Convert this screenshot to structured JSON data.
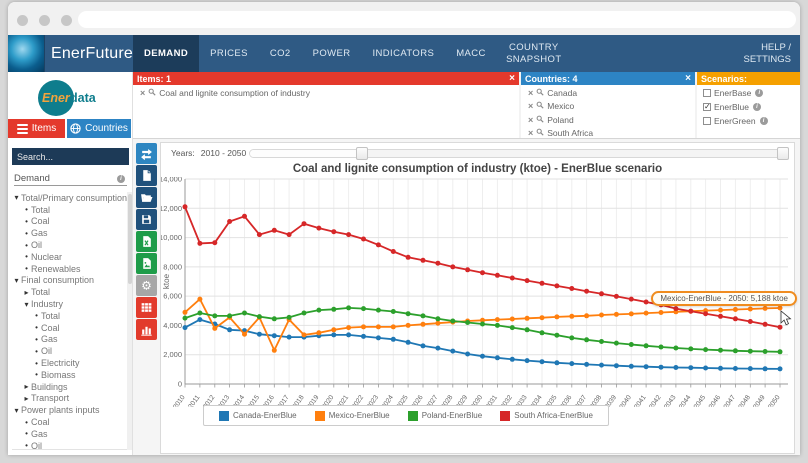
{
  "header": {
    "brand": "EnerFuture",
    "nav": [
      {
        "label": "DEMAND",
        "active": true
      },
      {
        "label": "PRICES",
        "active": false
      },
      {
        "label": "CO2",
        "active": false
      },
      {
        "label": "POWER",
        "active": false
      },
      {
        "label": "INDICATORS",
        "active": false
      },
      {
        "label": "MACC",
        "active": false
      },
      {
        "label": "COUNTRY SNAPSHOT",
        "active": false
      }
    ],
    "help": "HELP / SETTINGS"
  },
  "filters": {
    "items": {
      "title": "Items: 1",
      "rows": [
        "Coal and lignite consumption of industry"
      ]
    },
    "countries": {
      "title": "Countries: 4",
      "rows": [
        "Canada",
        "Mexico",
        "Poland",
        "South Africa"
      ]
    },
    "scenarios": {
      "title": "Scenarios:",
      "options": [
        {
          "label": "EnerBase",
          "checked": false
        },
        {
          "label": "EnerBlue",
          "checked": true
        },
        {
          "label": "EnerGreen",
          "checked": false
        }
      ]
    }
  },
  "sidebar": {
    "logo_primary": "Ener",
    "logo_secondary": "data",
    "tabs": [
      {
        "label": "Items",
        "icon": "menu-icon",
        "active": true
      },
      {
        "label": "Countries",
        "icon": "globe-icon",
        "active": false
      }
    ],
    "search_placeholder": "Search...",
    "category": "Demand",
    "tree": [
      {
        "label": "Total/Primary consumption",
        "level": 0,
        "state": "expanded"
      },
      {
        "label": "Total",
        "level": 1,
        "state": "leaf"
      },
      {
        "label": "Coal",
        "level": 1,
        "state": "leaf"
      },
      {
        "label": "Gas",
        "level": 1,
        "state": "leaf"
      },
      {
        "label": "Oil",
        "level": 1,
        "state": "leaf"
      },
      {
        "label": "Nuclear",
        "level": 1,
        "state": "leaf"
      },
      {
        "label": "Renewables",
        "level": 1,
        "state": "leaf"
      },
      {
        "label": "Final consumption",
        "level": 0,
        "state": "expanded"
      },
      {
        "label": "Total",
        "level": 1,
        "state": "collapsed"
      },
      {
        "label": "Industry",
        "level": 1,
        "state": "expanded"
      },
      {
        "label": "Total",
        "level": 2,
        "state": "leaf"
      },
      {
        "label": "Coal",
        "level": 2,
        "state": "leaf"
      },
      {
        "label": "Gas",
        "level": 2,
        "state": "leaf"
      },
      {
        "label": "Oil",
        "level": 2,
        "state": "leaf"
      },
      {
        "label": "Electricity",
        "level": 2,
        "state": "leaf"
      },
      {
        "label": "Biomass",
        "level": 2,
        "state": "leaf"
      },
      {
        "label": "Buildings",
        "level": 1,
        "state": "collapsed"
      },
      {
        "label": "Transport",
        "level": 1,
        "state": "collapsed"
      },
      {
        "label": "Power plants inputs",
        "level": 0,
        "state": "expanded"
      },
      {
        "label": "Coal",
        "level": 1,
        "state": "leaf"
      },
      {
        "label": "Gas",
        "level": 1,
        "state": "leaf"
      },
      {
        "label": "Oil",
        "level": 1,
        "state": "leaf"
      }
    ]
  },
  "toolbar": {
    "buttons": [
      {
        "name": "swap-arrows",
        "color": "#2e86c1"
      },
      {
        "name": "new-document",
        "color": "#20517c"
      },
      {
        "name": "open-folder",
        "color": "#20517c"
      },
      {
        "name": "save",
        "color": "#20517c"
      },
      {
        "name": "export-excel",
        "color": "#1e9c49"
      },
      {
        "name": "export-image",
        "color": "#1e9c49"
      },
      {
        "name": "settings-gear",
        "color": "#a6a6a6"
      },
      {
        "name": "data-table",
        "color": "#e23b2c"
      },
      {
        "name": "bar-chart",
        "color": "#e23b2c"
      }
    ]
  },
  "slider": {
    "label": "Years:",
    "value": "2010 - 2050"
  },
  "tooltip": {
    "text": "Mexico-EnerBlue - 2050: 5,188 ktoe"
  },
  "chart_data": {
    "type": "line",
    "title": "Coal and lignite consumption of industry (ktoe) - EnerBlue scenario",
    "ylabel": "ktoe",
    "ylim": [
      0,
      14000
    ],
    "ytick_step": 2000,
    "grid": true,
    "legend_position": "bottom",
    "x": [
      2010,
      2011,
      2012,
      2013,
      2014,
      2015,
      2016,
      2017,
      2018,
      2019,
      2020,
      2021,
      2022,
      2023,
      2024,
      2025,
      2026,
      2027,
      2028,
      2029,
      2030,
      2031,
      2032,
      2033,
      2034,
      2035,
      2036,
      2037,
      2038,
      2039,
      2040,
      2041,
      2042,
      2043,
      2044,
      2045,
      2046,
      2047,
      2048,
      2049,
      2050
    ],
    "series": [
      {
        "name": "Canada-EnerBlue",
        "color": "#1f77b4",
        "values": [
          3850,
          4400,
          4100,
          3700,
          3650,
          3400,
          3300,
          3200,
          3200,
          3300,
          3350,
          3350,
          3250,
          3150,
          3050,
          2850,
          2600,
          2450,
          2250,
          2050,
          1900,
          1790,
          1690,
          1600,
          1520,
          1450,
          1390,
          1340,
          1290,
          1250,
          1210,
          1180,
          1150,
          1130,
          1110,
          1090,
          1070,
          1060,
          1050,
          1040,
          1030
        ]
      },
      {
        "name": "Mexico-EnerBlue",
        "color": "#ff7f0e",
        "values": [
          4900,
          5800,
          3800,
          4550,
          3400,
          4550,
          2300,
          4400,
          3350,
          3500,
          3700,
          3850,
          3900,
          3900,
          3900,
          4000,
          4080,
          4150,
          4230,
          4300,
          4350,
          4400,
          4440,
          4490,
          4530,
          4580,
          4620,
          4660,
          4710,
          4750,
          4790,
          4840,
          4880,
          4930,
          4970,
          5010,
          5050,
          5090,
          5120,
          5160,
          5188
        ]
      },
      {
        "name": "Poland-EnerBlue",
        "color": "#2ca02c",
        "values": [
          4500,
          4850,
          4650,
          4650,
          4850,
          4600,
          4450,
          4550,
          4850,
          5050,
          5100,
          5200,
          5150,
          5050,
          4950,
          4800,
          4650,
          4450,
          4300,
          4200,
          4100,
          4000,
          3850,
          3700,
          3500,
          3330,
          3150,
          3020,
          2900,
          2790,
          2700,
          2610,
          2530,
          2460,
          2400,
          2350,
          2310,
          2270,
          2240,
          2220,
          2200
        ]
      },
      {
        "name": "South Africa-EnerBlue",
        "color": "#d62728",
        "values": [
          12100,
          9600,
          9650,
          11100,
          11450,
          10200,
          10500,
          10200,
          10950,
          10650,
          10400,
          10200,
          9900,
          9500,
          9050,
          8650,
          8450,
          8250,
          8000,
          7800,
          7600,
          7420,
          7240,
          7060,
          6880,
          6700,
          6520,
          6340,
          6160,
          5980,
          5800,
          5600,
          5400,
          5150,
          4970,
          4800,
          4620,
          4450,
          4270,
          4080,
          3880
        ]
      }
    ]
  }
}
